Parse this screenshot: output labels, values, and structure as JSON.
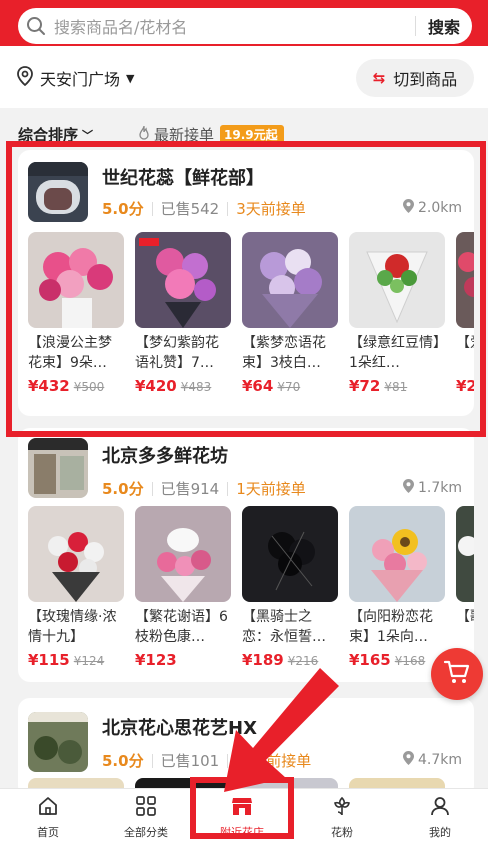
{
  "search": {
    "placeholder": "搜索商品名/花材名",
    "button": "搜索"
  },
  "location": {
    "name": "天安门广场",
    "switch_label": "切到商品"
  },
  "sort": {
    "default_label": "综合排序",
    "latest_label": "最新接单",
    "price_badge": "19.9元起"
  },
  "shops": [
    {
      "name": "世纪花蕊【鲜花部】",
      "rating": "5.0分",
      "sold": "已售542",
      "recent": "3天前接单",
      "distance": "2.0km",
      "products": [
        {
          "name": "【浪漫公主梦花束】9朵…",
          "price": "¥432",
          "old_price": "¥500"
        },
        {
          "name": "【梦幻紫韵花语礼赞】7…",
          "price": "¥420",
          "old_price": "¥483"
        },
        {
          "name": "【紫梦恋语花束】3枝白…",
          "price": "¥64",
          "old_price": "¥70"
        },
        {
          "name": "【绿意红豆情】1朵红…",
          "price": "¥72",
          "old_price": "¥81"
        },
        {
          "name": "【爱",
          "price": "¥2"
        }
      ]
    },
    {
      "name": "北京多多鲜花坊",
      "rating": "5.0分",
      "sold": "已售914",
      "recent": "1天前接单",
      "distance": "1.7km",
      "products": [
        {
          "name": "【玫瑰情缘·浓情十九】",
          "price": "¥115",
          "old_price": "¥124"
        },
        {
          "name": "【繁花谢语】6枝粉色康…",
          "price": "¥123",
          "old_price": ""
        },
        {
          "name": "【黑骑士之恋：永恒誓…",
          "price": "¥189",
          "old_price": "¥216"
        },
        {
          "name": "【向阳粉恋花束】1朵向…",
          "price": "¥165",
          "old_price": "¥168"
        },
        {
          "name": "【歌",
          "price": ""
        }
      ]
    },
    {
      "name": "北京花心思花艺HX",
      "rating": "5.0分",
      "sold": "已售101",
      "recent": "一周前接单",
      "distance": "4.7km"
    }
  ],
  "nav": [
    {
      "label": "首页",
      "icon": "home-icon"
    },
    {
      "label": "全部分类",
      "icon": "category-icon"
    },
    {
      "label": "附近花店",
      "icon": "shop-icon"
    },
    {
      "label": "花粉",
      "icon": "flower-icon"
    },
    {
      "label": "我的",
      "icon": "user-icon"
    }
  ],
  "colors": {
    "brand_red": "#e8202a",
    "orange": "#e8891d"
  }
}
